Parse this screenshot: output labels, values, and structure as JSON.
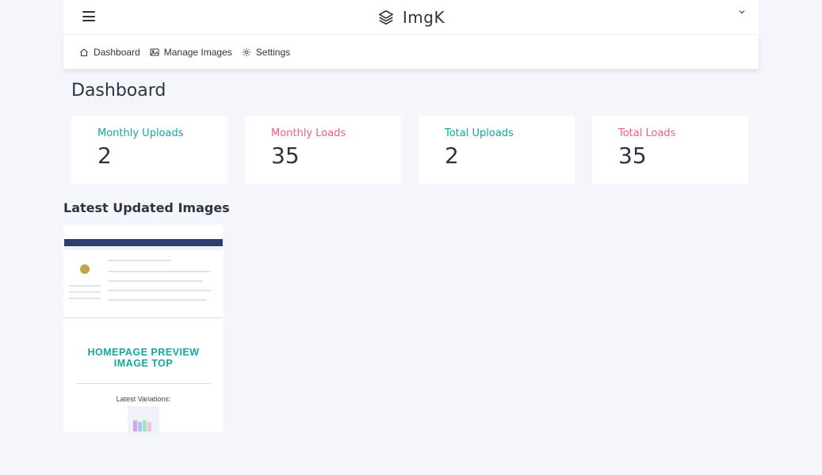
{
  "app": {
    "name": "ImgK"
  },
  "nav": {
    "items": [
      {
        "label": "Dashboard",
        "icon": "home-icon"
      },
      {
        "label": "Manage Images",
        "icon": "image-icon"
      },
      {
        "label": "Settings",
        "icon": "gear-icon"
      }
    ]
  },
  "page": {
    "title": "Dashboard"
  },
  "stats": [
    {
      "label": "Monthly Uploads",
      "value": "2",
      "color": "#13a7a0"
    },
    {
      "label": "Monthly Loads",
      "value": "35",
      "color": "#f0607a"
    },
    {
      "label": "Total Uploads",
      "value": "2",
      "color": "#13a7a0"
    },
    {
      "label": "Total Loads",
      "value": "35",
      "color": "#f0607a"
    }
  ],
  "latest": {
    "title": "Latest Updated Images",
    "items": [
      {
        "title_line1": "HOMEPAGE PREVIEW",
        "title_line2": "IMAGE TOP",
        "variations_label": "Latest Variations:"
      }
    ]
  },
  "colors": {
    "accent": "#13a7a0",
    "secondary": "#f0607a",
    "background": "#f4f6fb"
  }
}
